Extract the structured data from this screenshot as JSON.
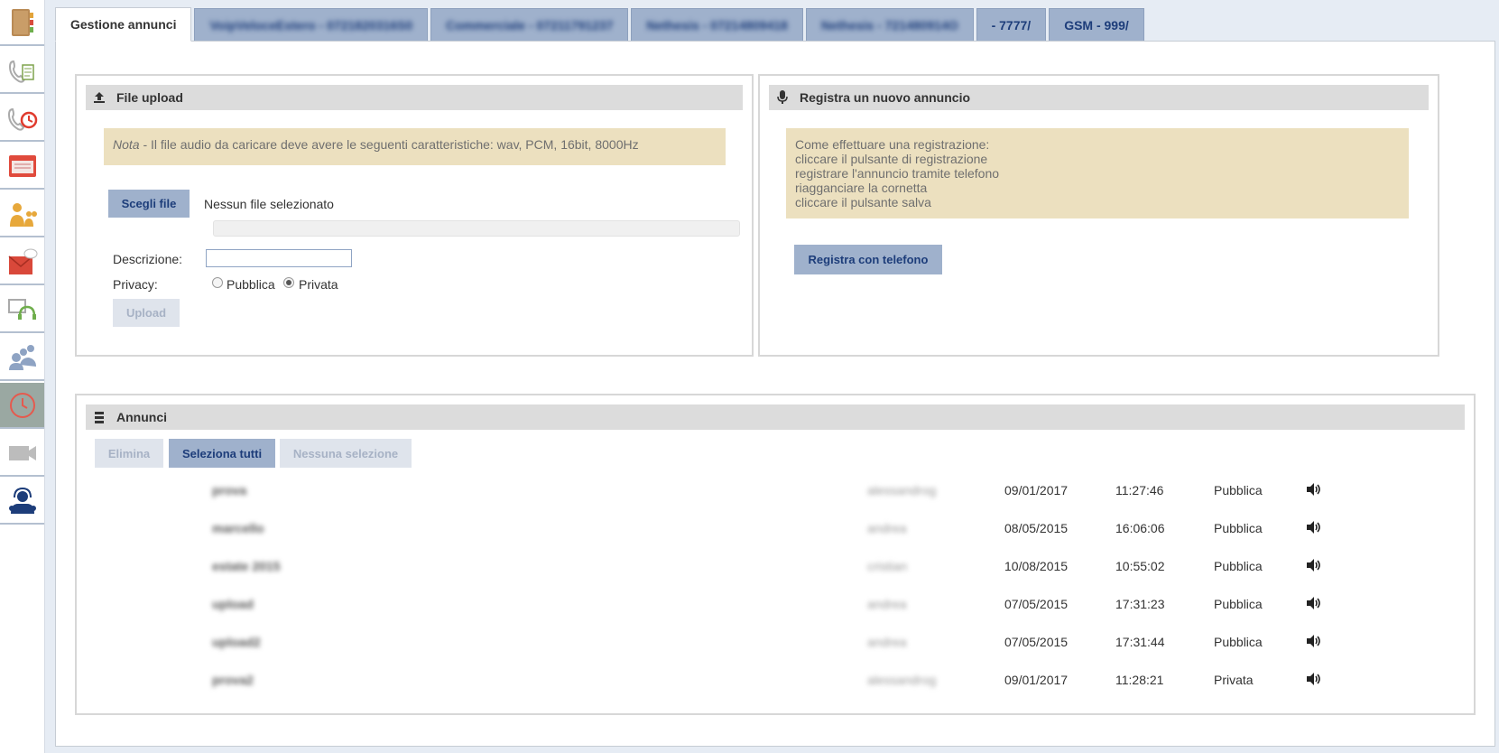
{
  "sidebar": {
    "items": [
      {
        "name": "contacts-book-icon"
      },
      {
        "name": "phone-document-icon"
      },
      {
        "name": "phone-history-icon"
      },
      {
        "name": "card-screen-icon"
      },
      {
        "name": "operators-users-icon"
      },
      {
        "name": "voicemail-envelope-icon"
      },
      {
        "name": "headset-window-icon"
      },
      {
        "name": "group-users-icon"
      },
      {
        "name": "clock-icon",
        "active": true
      },
      {
        "name": "video-camera-icon"
      },
      {
        "name": "helpdesk-operator-icon"
      }
    ]
  },
  "tabs": [
    {
      "label": "Gestione annunci",
      "active": true,
      "blurred": false
    },
    {
      "label": "VoipVeloceEstero - 0721820316S0",
      "active": false,
      "blurred": true
    },
    {
      "label": "Commerciale - 07211791237",
      "active": false,
      "blurred": true
    },
    {
      "label": "Nethesis - 07214809418",
      "active": false,
      "blurred": true
    },
    {
      "label": "Nethesis - 721480914O",
      "active": false,
      "blurred": true
    },
    {
      "label": "- 7777/",
      "active": false,
      "blurred": false
    },
    {
      "label": "GSM - 999/",
      "active": false,
      "blurred": false
    }
  ],
  "upload": {
    "title": "File upload",
    "note_prefix": "Nota",
    "note_text": " - Il file audio da caricare deve avere le seguenti caratteristiche: wav, PCM, 16bit, 8000Hz",
    "choose_file_label": "Scegli file",
    "no_file_text": "Nessun file selezionato",
    "description_label": "Descrizione:",
    "description_value": "",
    "privacy_label": "Privacy:",
    "privacy_public": "Pubblica",
    "privacy_private": "Privata",
    "privacy_selected": "Privata",
    "upload_button": "Upload"
  },
  "record": {
    "title": "Registra un nuovo annuncio",
    "instructions": [
      "Come effettuare una registrazione:",
      "cliccare il pulsante di registrazione",
      "registrare l'annuncio tramite telefono",
      "riagganciare la cornetta",
      "cliccare il pulsante salva"
    ],
    "record_button": "Registra con telefono"
  },
  "announcements": {
    "title": "Annunci",
    "buttons": {
      "delete": "Elimina",
      "select_all": "Seleziona tutti",
      "select_none": "Nessuna selezione"
    },
    "rows": [
      {
        "name": "prova",
        "user": "alessandrog",
        "date": "09/01/2017",
        "time": "11:27:46",
        "privacy": "Pubblica"
      },
      {
        "name": "marcello",
        "user": "andrea",
        "date": "08/05/2015",
        "time": "16:06:06",
        "privacy": "Pubblica"
      },
      {
        "name": "estate 2015",
        "user": "cristian",
        "date": "10/08/2015",
        "time": "10:55:02",
        "privacy": "Pubblica"
      },
      {
        "name": "upload",
        "user": "andrea",
        "date": "07/05/2015",
        "time": "17:31:23",
        "privacy": "Pubblica"
      },
      {
        "name": "upload2",
        "user": "andrea",
        "date": "07/05/2015",
        "time": "17:31:44",
        "privacy": "Pubblica"
      },
      {
        "name": "prova2",
        "user": "alessandrog",
        "date": "09/01/2017",
        "time": "11:28:21",
        "privacy": "Privata"
      }
    ]
  },
  "colors": {
    "tab_blue": "#9fb1cc",
    "tab_text": "#1d3d7a",
    "note_bg": "#ece0bf",
    "panel_head": "#dcdcdc"
  }
}
